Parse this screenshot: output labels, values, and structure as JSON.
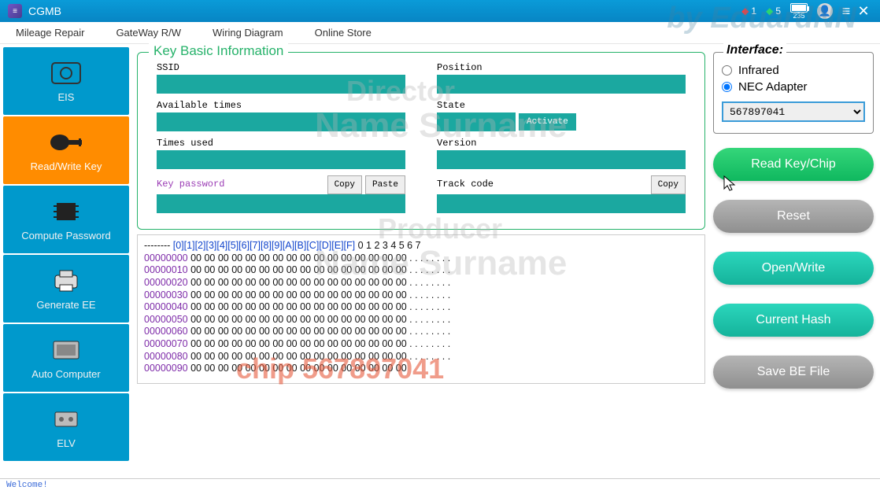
{
  "titlebar": {
    "app_name": "CGMB",
    "gem_red_count": "1",
    "gem_green_count": "5",
    "battery": "235"
  },
  "watermarks": {
    "byline": "by EduardNN",
    "director": "Director",
    "name1": "Name Surname",
    "producer": "Producer",
    "name2": "Name Surname",
    "chip": "chip 567897041"
  },
  "menubar": [
    "Mileage Repair",
    "GateWay R/W",
    "Wiring Diagram",
    "Online Store"
  ],
  "sidebar": [
    {
      "label": "EIS"
    },
    {
      "label": "Read/Write Key"
    },
    {
      "label": "Compute Password"
    },
    {
      "label": "Generate EE"
    },
    {
      "label": "Auto Computer"
    },
    {
      "label": "ELV"
    }
  ],
  "key_info": {
    "title": "Key Basic Information",
    "fields": {
      "ssid": {
        "label": "SSID",
        "value": ""
      },
      "position": {
        "label": "Position",
        "value": ""
      },
      "available_times": {
        "label": "Available times",
        "value": ""
      },
      "state": {
        "label": "State",
        "value": "",
        "activate_label": "Activate"
      },
      "times_used": {
        "label": "Times used",
        "value": ""
      },
      "version": {
        "label": "Version",
        "value": ""
      },
      "key_password": {
        "label": "Key password",
        "value": "",
        "copy_label": "Copy",
        "paste_label": "Paste"
      },
      "track_code": {
        "label": "Track code",
        "value": "",
        "copy_label": "Copy"
      }
    }
  },
  "hex": {
    "header_dashes": "--------",
    "header_cols": "  [0][1][2][3][4][5][6][7][8][9][A][B][C][D][E][F]",
    "header_ascii": "  0 1 2 3 4 5 6 7",
    "rows": [
      {
        "addr": "00000000",
        "bytes": "  00 00 00 00 00 00 00 00 00 00 00 00 00 00 00 00",
        "ascii": "  . . . . . . . ."
      },
      {
        "addr": "00000010",
        "bytes": "  00 00 00 00 00 00 00 00 00 00 00 00 00 00 00 00",
        "ascii": "  . . . . . . . ."
      },
      {
        "addr": "00000020",
        "bytes": "  00 00 00 00 00 00 00 00 00 00 00 00 00 00 00 00",
        "ascii": "  . . . . . . . ."
      },
      {
        "addr": "00000030",
        "bytes": "  00 00 00 00 00 00 00 00 00 00 00 00 00 00 00 00",
        "ascii": "  . . . . . . . ."
      },
      {
        "addr": "00000040",
        "bytes": "  00 00 00 00 00 00 00 00 00 00 00 00 00 00 00 00",
        "ascii": "  . . . . . . . ."
      },
      {
        "addr": "00000050",
        "bytes": "  00 00 00 00 00 00 00 00 00 00 00 00 00 00 00 00",
        "ascii": "  . . . . . . . ."
      },
      {
        "addr": "00000060",
        "bytes": "  00 00 00 00 00 00 00 00 00 00 00 00 00 00 00 00",
        "ascii": "  . . . . . . . ."
      },
      {
        "addr": "00000070",
        "bytes": "  00 00 00 00 00 00 00 00 00 00 00 00 00 00 00 00",
        "ascii": "  . . . . . . . ."
      },
      {
        "addr": "00000080",
        "bytes": "  00 00 00 00 00 00 00 00 00 00 00 00 00 00 00 00",
        "ascii": "  . . . . . . . ."
      },
      {
        "addr": "00000090",
        "bytes": "  00 00 00 00 00 00 00 00 00 00 00 00 00 00 00 00",
        "ascii": ""
      }
    ]
  },
  "right": {
    "interface_title": "Interface:",
    "radio_infrared": "Infrared",
    "radio_nec": "NEC Adapter",
    "select_value": "567897041",
    "btn_read": "Read Key/Chip",
    "btn_reset": "Reset",
    "btn_open": "Open/Write",
    "btn_hash": "Current Hash",
    "btn_save": "Save BE File"
  },
  "status": "Welcome!"
}
